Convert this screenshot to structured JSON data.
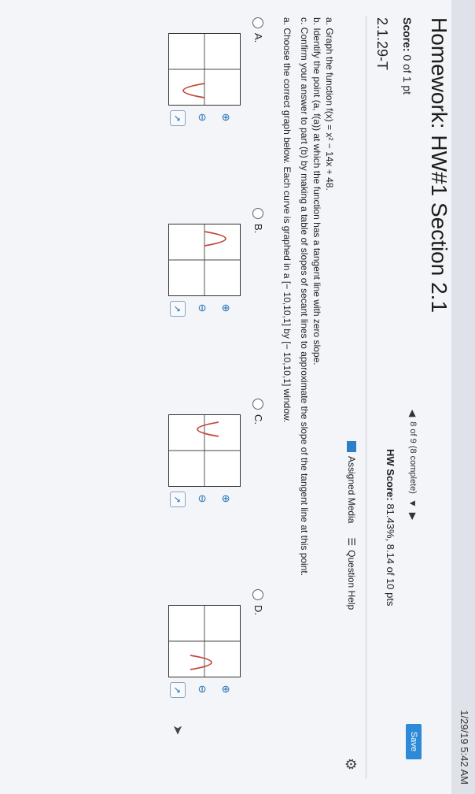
{
  "top": {
    "time": "1/29/19 5:42 AM"
  },
  "header": {
    "title": "Homework: HW#1 Section 2.1",
    "score_label": "Score:",
    "score_value": "0 of 1 pt",
    "progress": "8 of 9 (8 complete)",
    "save_label": "Save",
    "hw_score_label": "HW Score:",
    "hw_score_value": "81.43%, 8.14 of 10 pts",
    "section": "2.1.29-T"
  },
  "tools": {
    "assigned_media": "Assigned Media",
    "question_help": "Question Help"
  },
  "question": {
    "line_a": "a. Graph the function f(x) = x² − 14x + 48.",
    "line_b": "b. Identify the point (a, f(a)) at which the function has a tangent line with zero slope.",
    "line_c": "c. Confirm your answer to part (b) by making a table of slopes of secant lines to approximate the slope of the tangent line at this point.",
    "instruction": "a. Choose the correct graph below. Each curve is graphed in a [− 10,10,1] by [− 10,10,1] window."
  },
  "options": [
    {
      "label": "A."
    },
    {
      "label": "B."
    },
    {
      "label": "C."
    },
    {
      "label": "D."
    }
  ],
  "icons": [
    "zoom-in-icon",
    "zoom-out-icon",
    "popout-icon",
    "gear-icon",
    "arrow-cursor-icon"
  ]
}
